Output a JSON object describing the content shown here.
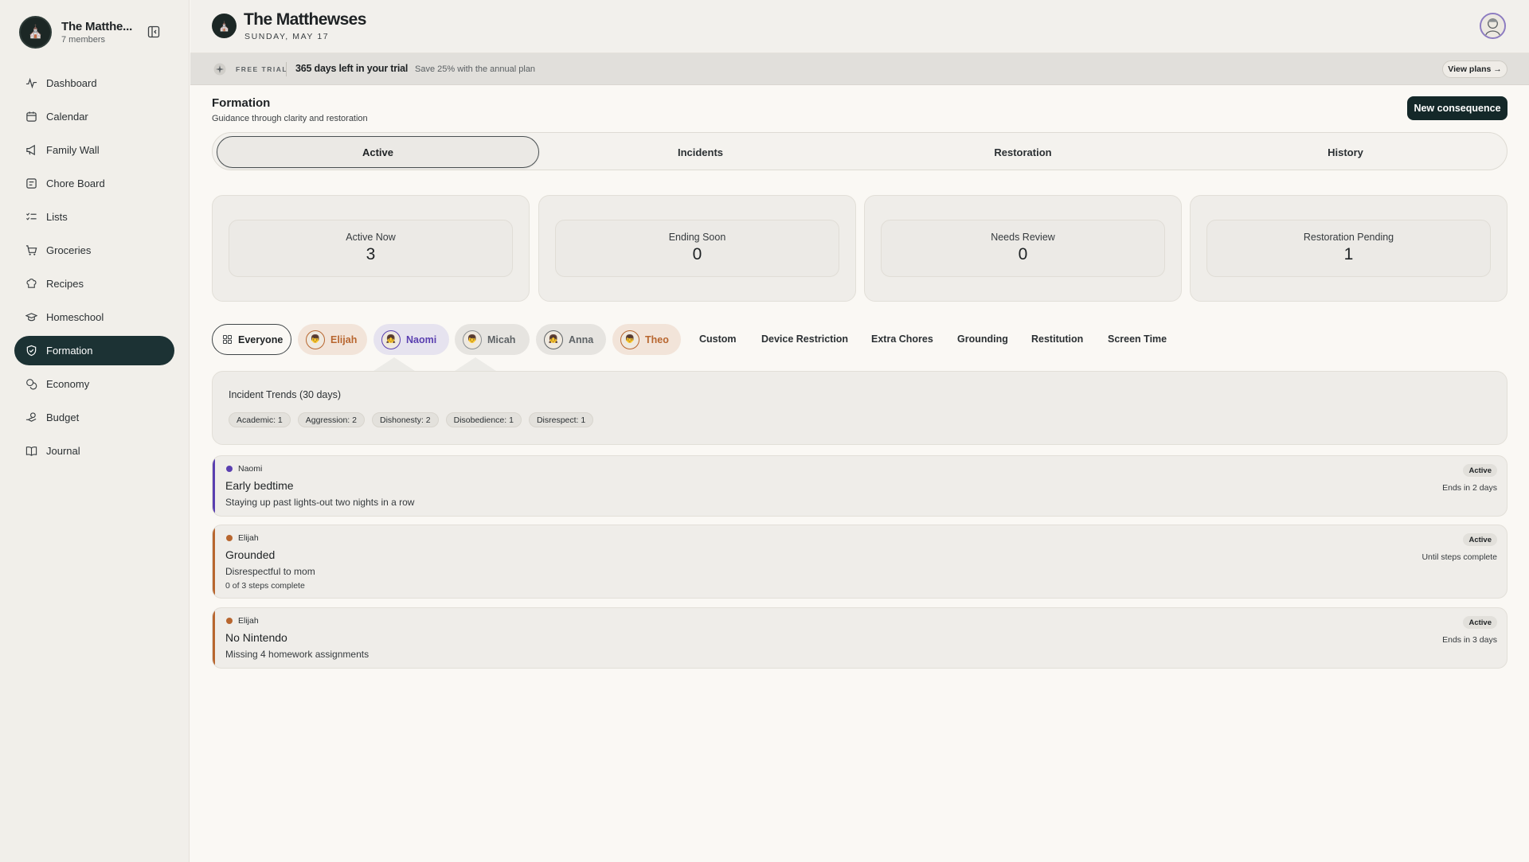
{
  "sidebar": {
    "family_name": "The Matthe...",
    "members": "7 members",
    "items": [
      {
        "label": "Dashboard",
        "icon": "pulse-icon"
      },
      {
        "label": "Calendar",
        "icon": "calendar-icon"
      },
      {
        "label": "Family Wall",
        "icon": "megaphone-icon"
      },
      {
        "label": "Chore Board",
        "icon": "board-icon"
      },
      {
        "label": "Lists",
        "icon": "checklist-icon"
      },
      {
        "label": "Groceries",
        "icon": "cart-icon"
      },
      {
        "label": "Recipes",
        "icon": "chef-hat-icon"
      },
      {
        "label": "Homeschool",
        "icon": "graduation-cap-icon"
      },
      {
        "label": "Formation",
        "icon": "shield-check-icon",
        "active": true
      },
      {
        "label": "Economy",
        "icon": "coins-icon"
      },
      {
        "label": "Budget",
        "icon": "hand-coins-icon"
      },
      {
        "label": "Journal",
        "icon": "book-icon"
      }
    ]
  },
  "header": {
    "title": "The Matthewses",
    "date": "SUNDAY, MAY 17"
  },
  "trial": {
    "badge": "FREE TRIAL",
    "days": "365 days left in your trial",
    "save": "Save 25% with the annual plan",
    "button": "View plans →"
  },
  "section": {
    "title": "Formation",
    "subtitle": "Guidance through clarity and restoration",
    "new_button": "New consequence"
  },
  "tabs": [
    "Active",
    "Incidents",
    "Restoration",
    "History"
  ],
  "stats": [
    {
      "label": "Active Now",
      "value": "3"
    },
    {
      "label": "Ending Soon",
      "value": "0"
    },
    {
      "label": "Needs Review",
      "value": "0"
    },
    {
      "label": "Restoration Pending",
      "value": "1"
    }
  ],
  "filters": {
    "everyone": "Everyone",
    "people": [
      {
        "name": "Elijah",
        "color": "#b8662f",
        "bg": "#f2e4d9"
      },
      {
        "name": "Naomi",
        "color": "#5a3fb0",
        "bg": "#e6e3ef"
      },
      {
        "name": "Micah",
        "color": "#6d7174",
        "bg": "#e6e4e0"
      },
      {
        "name": "Anna",
        "color": "#6d7174",
        "bg": "#e6e4e0"
      },
      {
        "name": "Theo",
        "color": "#b8662f",
        "bg": "#f2e4d9"
      }
    ],
    "categories": [
      "Custom",
      "Device Restriction",
      "Extra Chores",
      "Grounding",
      "Restitution",
      "Screen Time"
    ]
  },
  "trends": {
    "title": "Incident Trends (30 days)",
    "chips": [
      "Academic: 1",
      "Aggression: 2",
      "Dishonesty: 2",
      "Disobedience: 1",
      "Disrespect: 1"
    ]
  },
  "cards": [
    {
      "person": "Naomi",
      "color": "#5a3fb0",
      "title": "Early bedtime",
      "desc": "Staying up past lights-out two nights in a row",
      "status": "Active",
      "ends": "Ends in 2 days"
    },
    {
      "person": "Elijah",
      "color": "#b8662f",
      "title": "Grounded",
      "desc": "Disrespectful to mom",
      "steps": "0 of 3 steps complete",
      "status": "Active",
      "ends": "Until steps complete"
    },
    {
      "person": "Elijah",
      "color": "#b8662f",
      "title": "No Nintendo",
      "desc": "Missing 4 homework assignments",
      "status": "Active",
      "ends": "Ends in 3 days"
    }
  ]
}
